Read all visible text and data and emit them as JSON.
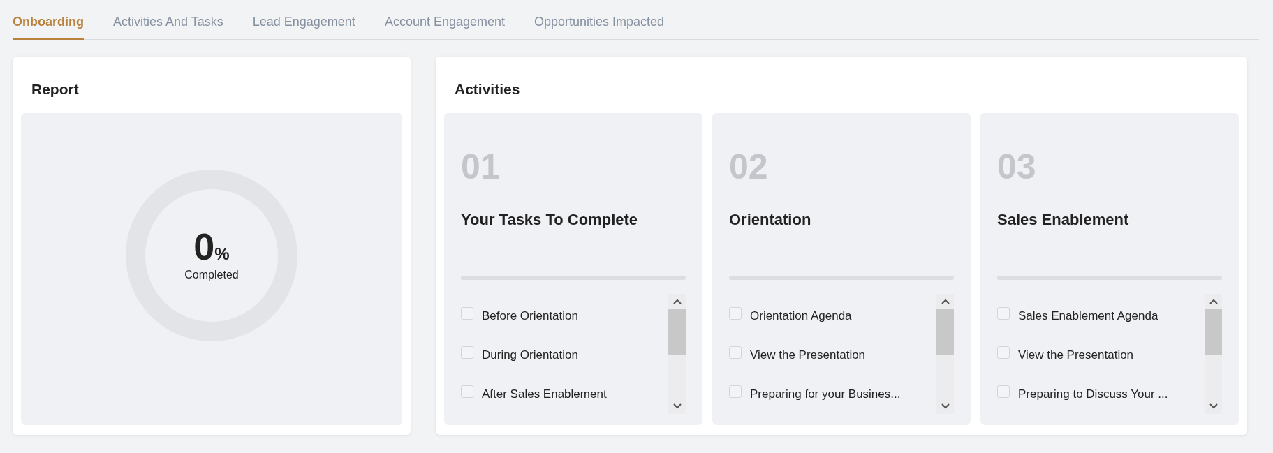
{
  "tabs": [
    {
      "label": "Onboarding",
      "selected": true
    },
    {
      "label": "Activities And Tasks",
      "selected": false
    },
    {
      "label": "Lead Engagement",
      "selected": false
    },
    {
      "label": "Account Engagement",
      "selected": false
    },
    {
      "label": "Opportunities Impacted",
      "selected": false
    }
  ],
  "report": {
    "title": "Report",
    "level": 0,
    "value": "0",
    "unit": "%",
    "caption": "Completed"
  },
  "activities": {
    "title": "Activities",
    "steps": [
      {
        "number": "01",
        "title": "Your Tasks To Complete",
        "items": [
          {
            "label": "Before Orientation",
            "checked": false
          },
          {
            "label": "During Orientation",
            "checked": false
          },
          {
            "label": "After Sales Enablement",
            "checked": false
          }
        ]
      },
      {
        "number": "02",
        "title": "Orientation",
        "items": [
          {
            "label": "Orientation Agenda",
            "checked": false
          },
          {
            "label": "View the Presentation",
            "checked": false
          },
          {
            "label": "Preparing for your Busines...",
            "checked": false
          }
        ]
      },
      {
        "number": "03",
        "title": "Sales Enablement",
        "items": [
          {
            "label": "Sales Enablement Agenda",
            "checked": false
          },
          {
            "label": "View the Presentation",
            "checked": false
          },
          {
            "label": "Preparing to Discuss Your ...",
            "checked": false
          }
        ]
      }
    ]
  }
}
